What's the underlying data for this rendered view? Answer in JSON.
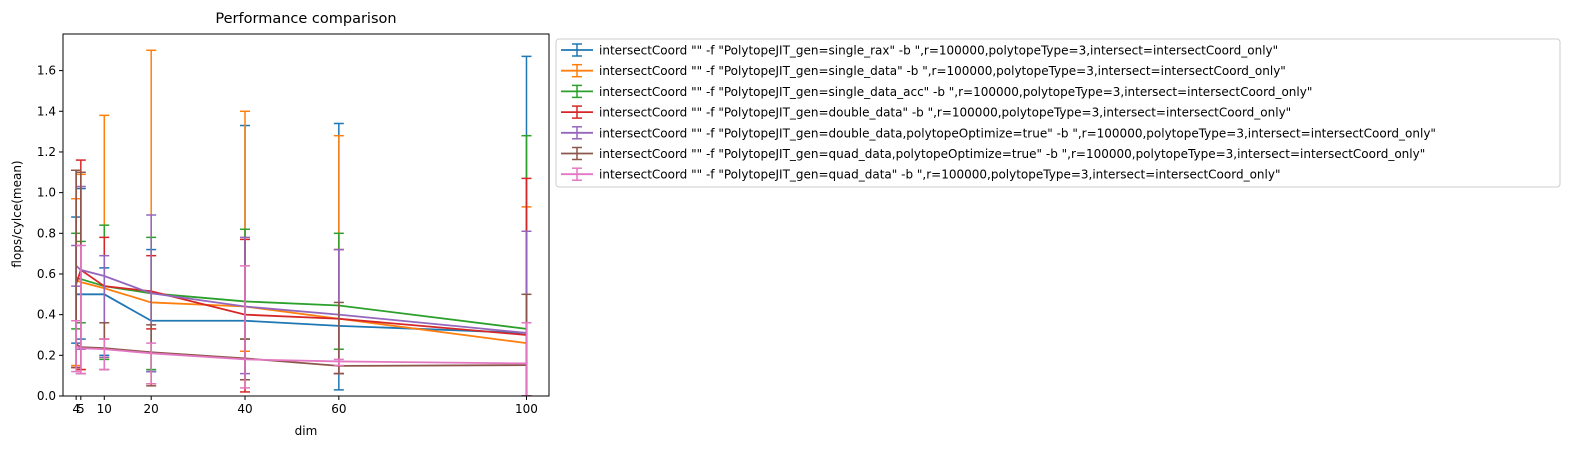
{
  "chart_data": {
    "type": "line",
    "title": "Performance comparison",
    "xlabel": "dim",
    "ylabel": "flops/cylce(mean)",
    "x": [
      4,
      5,
      10,
      20,
      40,
      60,
      100
    ],
    "xticks": [
      4,
      5,
      10,
      20,
      40,
      60,
      100
    ],
    "yticks": [
      0.0,
      0.2,
      0.4,
      0.6,
      0.8,
      1.0,
      1.2,
      1.4,
      1.6
    ],
    "ytick_labels": [
      "0.0",
      "0.2",
      "0.4",
      "0.6",
      "0.8",
      "1.0",
      "1.2",
      "1.4",
      "1.6"
    ],
    "xlim": [
      1.2,
      104.8
    ],
    "ylim": [
      0,
      1.78
    ],
    "grid": false,
    "legend_position": "outside upper right",
    "error_bars": true,
    "series": [
      {
        "name": "intersectCoord \"\" -f \"PolytopeJIT_gen=single_rax\" -b \",r=100000,polytopeType=3,intersect=intersectCoord_only\"",
        "color": "#1f77b4",
        "values": [
          0.5,
          0.5,
          0.5,
          0.37,
          0.37,
          0.345,
          0.31
        ],
        "err_low": [
          0.26,
          0.28,
          0.2,
          0.12,
          0.08,
          0.03,
          0.0
        ],
        "err_high": [
          0.88,
          1.02,
          0.63,
          0.72,
          1.33,
          1.34,
          1.67
        ]
      },
      {
        "name": "intersectCoord \"\" -f \"PolytopeJIT_gen=single_data\" -b \",r=100000,polytopeType=3,intersect=intersectCoord_only\"",
        "color": "#ff7f0e",
        "values": [
          0.57,
          0.56,
          0.53,
          0.46,
          0.44,
          0.38,
          0.26
        ],
        "err_low": [
          0.15,
          0.13,
          0.19,
          0.06,
          0.22,
          0.11,
          0.0
        ],
        "err_high": [
          0.97,
          1.09,
          1.38,
          1.7,
          1.4,
          1.28,
          0.93
        ]
      },
      {
        "name": "intersectCoord \"\" -f \"PolytopeJIT_gen=single_data_acc\" -b \",r=100000,polytopeType=3,intersect=intersectCoord_only\"",
        "color": "#2ca02c",
        "values": [
          0.58,
          0.575,
          0.54,
          0.505,
          0.465,
          0.445,
          0.33
        ],
        "err_low": [
          0.33,
          0.36,
          0.18,
          0.13,
          0.28,
          0.23,
          0.0
        ],
        "err_high": [
          0.8,
          0.76,
          0.84,
          0.78,
          0.82,
          0.8,
          1.28
        ]
      },
      {
        "name": "intersectCoord \"\" -f \"PolytopeJIT_gen=double_data\" -b \",r=100000,polytopeType=3,intersect=intersectCoord_only\"",
        "color": "#d62728",
        "values": [
          0.55,
          0.62,
          0.54,
          0.515,
          0.4,
          0.38,
          0.3
        ],
        "err_low": [
          0.14,
          0.13,
          0.28,
          0.33,
          0.02,
          0.11,
          0.0
        ],
        "err_high": [
          1.11,
          1.16,
          0.78,
          0.69,
          0.77,
          0.72,
          1.07
        ]
      },
      {
        "name": "intersectCoord \"\" -f \"PolytopeJIT_gen=double_data,polytopeOptimize=true\" -b \",r=100000,polytopeType=3,intersect=intersectCoord_only\"",
        "color": "#9467bd",
        "values": [
          0.64,
          0.62,
          0.59,
          0.505,
          0.44,
          0.4,
          0.31
        ],
        "err_low": [
          0.54,
          0.23,
          0.19,
          0.12,
          0.11,
          0.11,
          0.0
        ],
        "err_high": [
          0.74,
          1.03,
          0.69,
          0.89,
          0.78,
          0.72,
          0.81
        ]
      },
      {
        "name": "intersectCoord \"\" -f \"PolytopeJIT_gen=quad_data,polytopeOptimize=true\" -b \",r=100000,polytopeType=3,intersect=intersectCoord_only\"",
        "color": "#8c564b",
        "values": [
          0.255,
          0.24,
          0.235,
          0.215,
          0.185,
          0.148,
          0.152
        ],
        "err_low": [
          0.14,
          0.11,
          0.13,
          0.05,
          0.08,
          0.11,
          0.0
        ],
        "err_high": [
          1.11,
          1.1,
          0.36,
          0.35,
          0.28,
          0.46,
          0.5
        ]
      },
      {
        "name": "intersectCoord \"\" -f \"PolytopeJIT_gen=quad_data\" -b \",r=100000,polytopeType=3,intersect=intersectCoord_only\"",
        "color": "#e377c2",
        "values": [
          0.245,
          0.235,
          0.23,
          0.21,
          0.18,
          0.17,
          0.16
        ],
        "err_low": [
          0.12,
          0.11,
          0.13,
          0.06,
          0.04,
          0.15,
          0.0
        ],
        "err_high": [
          0.37,
          0.74,
          0.28,
          0.26,
          0.64,
          0.18,
          0.36
        ]
      }
    ]
  }
}
